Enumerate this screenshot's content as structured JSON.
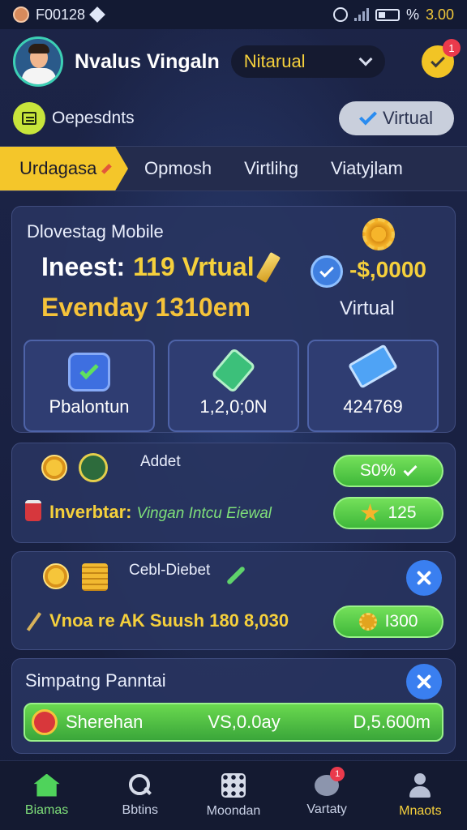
{
  "status_bar": {
    "carrier": "F00128",
    "battery_text": "%",
    "time": "3.00"
  },
  "header": {
    "username": "Nvalus Vingaln",
    "mode_select": "Nitarual",
    "notification_count": "1"
  },
  "subheader": {
    "label": "Oepesdnts",
    "virtual_button": "Virtual"
  },
  "tabs": [
    {
      "label": "Urdagasa",
      "active": true
    },
    {
      "label": "Opmosh"
    },
    {
      "label": "Virtlihg"
    },
    {
      "label": "Viatyjlam"
    }
  ],
  "main_card": {
    "title": "Dlovestag Mobile",
    "invest_label": "Ineest:",
    "invest_value": "119 Vrtual",
    "amount": "-$,0000",
    "eveday": "Evenday 1310em",
    "virtual_label": "Virtual",
    "stats": [
      {
        "value": "Pbalontun"
      },
      {
        "value": "1,2,0;0N"
      },
      {
        "value": "424769"
      }
    ]
  },
  "card_addet": {
    "label": "Addet",
    "row_text": "Inverbtar:",
    "row_subtext": "Vingan Intcu Eiewal",
    "pill_top": "S0%",
    "pill_bottom": "125"
  },
  "card_cebl": {
    "label": "Cebl-Diebet",
    "row_text": "Vnoa re AK Suush 180 8,030",
    "pill": "I300"
  },
  "card_simpatng": {
    "label": "Simpatng Panntai",
    "bar_left": "Sherehan",
    "bar_mid": "VS,0.0ay",
    "bar_right": "D,5.600m"
  },
  "bottom_nav": [
    {
      "label": "Biamas",
      "icon": "home-icon"
    },
    {
      "label": "Bbtins",
      "icon": "search-icon"
    },
    {
      "label": "Moondan",
      "icon": "grid-icon"
    },
    {
      "label": "Vartaty",
      "icon": "chat-icon",
      "badge": "1"
    },
    {
      "label": "Mnaots",
      "icon": "user-icon"
    }
  ],
  "colors": {
    "accent_yellow": "#f4c62a",
    "accent_green": "#4fd35b",
    "accent_blue": "#3a7ff0",
    "background": "#1a2140"
  }
}
